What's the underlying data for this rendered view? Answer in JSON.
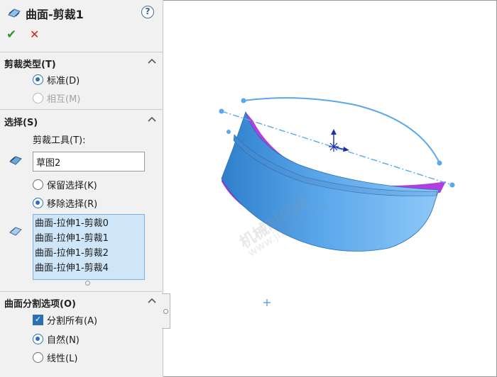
{
  "header": {
    "title": "曲面-剪裁1",
    "help_label": "?",
    "ok_label": "✔",
    "cancel_label": "✕"
  },
  "trim_type": {
    "title": "剪裁类型(T)",
    "options": [
      {
        "label": "标准(D)",
        "selected": true,
        "enabled": true
      },
      {
        "label": "相互(M)",
        "selected": false,
        "enabled": false
      }
    ]
  },
  "selection": {
    "title": "选择(S)",
    "trim_tool_label": "剪裁工具(T):",
    "trim_tool_value": "草图2",
    "options": [
      {
        "label": "保留选择(K)",
        "selected": false
      },
      {
        "label": "移除选择(R)",
        "selected": true
      }
    ],
    "selected_items": [
      "曲面-拉伸1-剪裁0",
      "曲面-拉伸1-剪裁1",
      "曲面-拉伸1-剪裁2",
      "曲面-拉伸1-剪裁4"
    ]
  },
  "split_options": {
    "title": "曲面分割选项(O)",
    "split_all": {
      "label": "分割所有(A)",
      "checked": true
    },
    "options": [
      {
        "label": "自然(N)",
        "selected": true
      },
      {
        "label": "线性(L)",
        "selected": false
      }
    ]
  },
  "viewport": {
    "watermark_line1": "机械时代网",
    "watermark_line2": "www.jixage.com"
  },
  "colors": {
    "surface_blue": "#4a9de0",
    "surface_magenta": "#b03fe0",
    "sketch_curve": "#5aa8ec",
    "radio_accent": "#2b6fb6",
    "ok_green": "#2e9a2e",
    "cancel_red": "#d42020"
  }
}
